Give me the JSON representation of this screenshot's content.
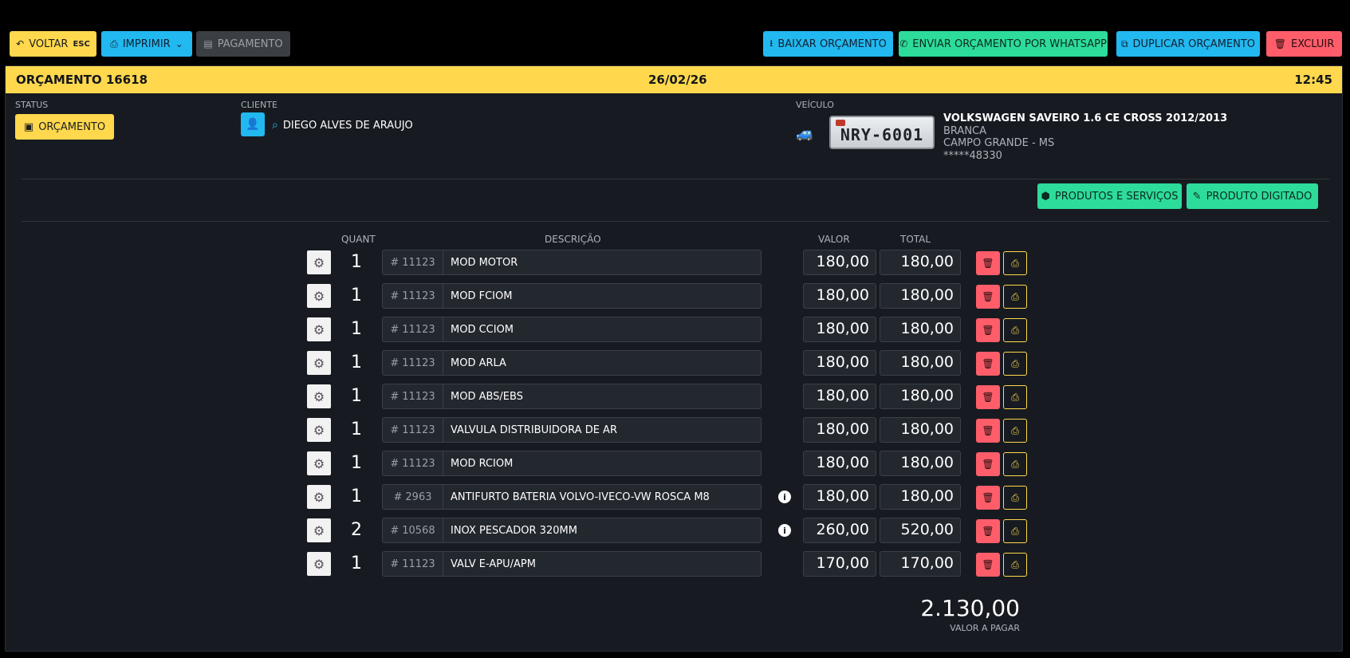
{
  "toolbar": {
    "back_label": "VOLTAR",
    "back_key": "ESC",
    "print_label": "IMPRIMIR",
    "payment_label": "PAGAMENTO",
    "download_label": "BAIXAR ORÇAMENTO",
    "whatsapp_label": "ENVIAR ORÇAMENTO POR WHATSAPP",
    "duplicate_label": "DUPLICAR ORÇAMENTO",
    "delete_label": "EXCLUIR"
  },
  "header": {
    "title": "ORÇAMENTO 16618",
    "date": "26/02/26",
    "time": "12:45"
  },
  "status": {
    "label": "STATUS",
    "value": "ORÇAMENTO"
  },
  "client": {
    "label": "CLIENTE",
    "name": "DIEGO ALVES DE ARAUJO"
  },
  "vehicle": {
    "label": "VEÍCULO",
    "plate": "NRY-6001",
    "model": "VOLKSWAGEN SAVEIRO 1.6 CE CROSS 2012/2013",
    "color": "BRANCA",
    "city": "CAMPO GRANDE - MS",
    "chassis": "*****48330"
  },
  "actions": {
    "products_label": "PRODUTOS E SERVIÇOS",
    "typed_label": "PRODUTO DIGITADO"
  },
  "columns": {
    "qty": "QUANT",
    "desc": "DESCRIÇÃO",
    "value": "VALOR",
    "total": "TOTAL"
  },
  "items": [
    {
      "qty": "1",
      "code": "11123",
      "desc": "MOD MOTOR",
      "value": "180,00",
      "total": "180,00",
      "info": false
    },
    {
      "qty": "1",
      "code": "11123",
      "desc": "MOD FCIOM",
      "value": "180,00",
      "total": "180,00",
      "info": false
    },
    {
      "qty": "1",
      "code": "11123",
      "desc": "MOD CCIOM",
      "value": "180,00",
      "total": "180,00",
      "info": false
    },
    {
      "qty": "1",
      "code": "11123",
      "desc": "MOD ARLA",
      "value": "180,00",
      "total": "180,00",
      "info": false
    },
    {
      "qty": "1",
      "code": "11123",
      "desc": "MOD ABS/EBS",
      "value": "180,00",
      "total": "180,00",
      "info": false
    },
    {
      "qty": "1",
      "code": "11123",
      "desc": "VALVULA DISTRIBUIDORA DE AR",
      "value": "180,00",
      "total": "180,00",
      "info": false
    },
    {
      "qty": "1",
      "code": "11123",
      "desc": "MOD RCIOM",
      "value": "180,00",
      "total": "180,00",
      "info": false
    },
    {
      "qty": "1",
      "code": "2963",
      "desc": "ANTIFURTO BATERIA VOLVO-IVECO-VW ROSCA M8",
      "value": "180,00",
      "total": "180,00",
      "info": true
    },
    {
      "qty": "2",
      "code": "10568",
      "desc": "INOX PESCADOR 320MM",
      "value": "260,00",
      "total": "520,00",
      "info": true
    },
    {
      "qty": "1",
      "code": "11123",
      "desc": "VALV E-APU/APM",
      "value": "170,00",
      "total": "170,00",
      "info": false
    }
  ],
  "summary": {
    "total": "2.130,00",
    "label": "VALOR A PAGAR"
  }
}
